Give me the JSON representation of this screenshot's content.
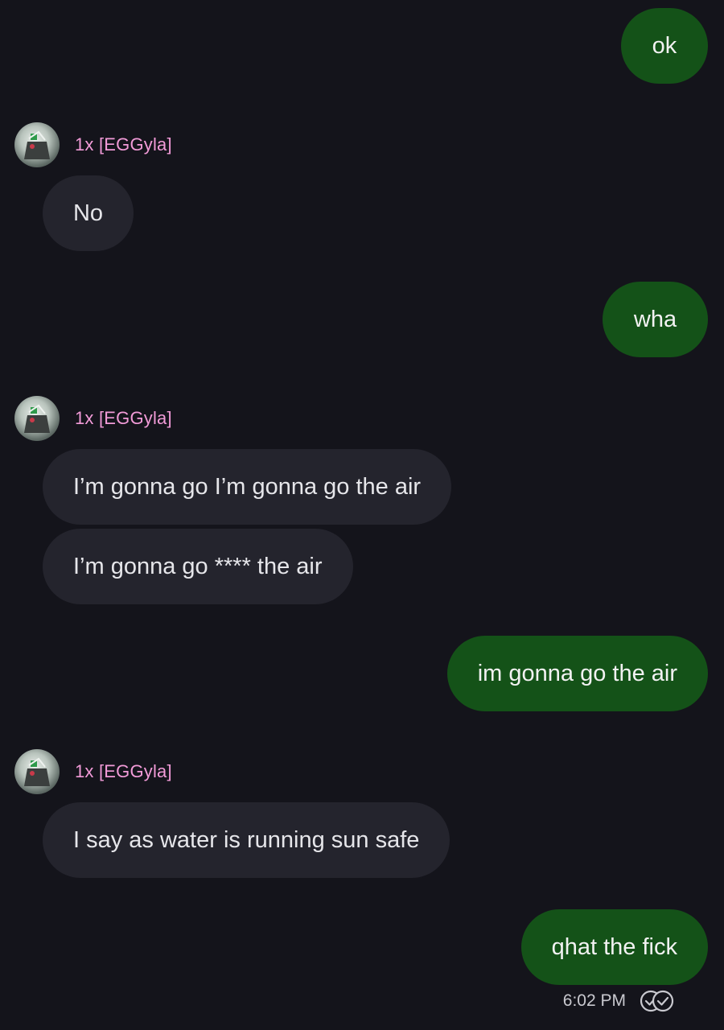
{
  "conversation": {
    "messages": [
      {
        "id": "m1",
        "direction": "outgoing",
        "text": "ok"
      },
      {
        "id": "m2",
        "direction": "incoming",
        "sender": "1x [EGGyla]",
        "text": "No"
      },
      {
        "id": "m3",
        "direction": "outgoing",
        "text": "wha"
      },
      {
        "id": "m4",
        "direction": "incoming",
        "sender": "1x [EGGyla]",
        "text": "I’m gonna go I’m gonna go the air"
      },
      {
        "id": "m5",
        "direction": "incoming",
        "text": "I’m gonna go **** the air"
      },
      {
        "id": "m6",
        "direction": "outgoing",
        "text": "im gonna go the air"
      },
      {
        "id": "m7",
        "direction": "incoming",
        "sender": "1x [EGGyla]",
        "text": "I say as water is running sun safe"
      },
      {
        "id": "m8",
        "direction": "outgoing",
        "text": "qhat the fick"
      }
    ],
    "last_timestamp": "6:02 PM",
    "read_status_icon": "read-receipt-icon"
  },
  "theme": {
    "background": "#14141b",
    "outgoing_bubble": "#145218",
    "incoming_bubble": "#24242d",
    "sender_name_color": "#f29bd8"
  }
}
